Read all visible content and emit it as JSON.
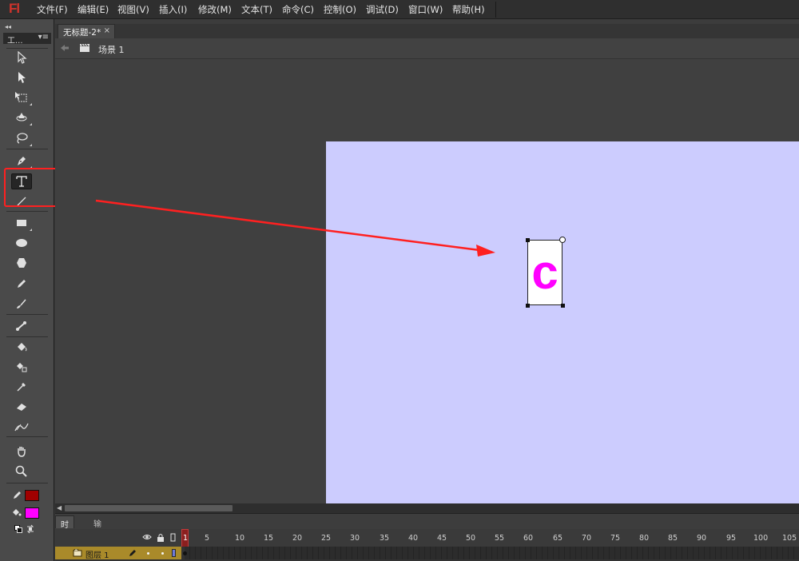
{
  "app": {
    "logo": "Fl"
  },
  "menu": {
    "items": [
      {
        "label": "文件(F)"
      },
      {
        "label": "编辑(E)"
      },
      {
        "label": "视图(V)"
      },
      {
        "label": "插入(I)"
      },
      {
        "label": "修改(M)"
      },
      {
        "label": "文本(T)"
      },
      {
        "label": "命令(C)"
      },
      {
        "label": "控制(O)"
      },
      {
        "label": "调试(D)"
      },
      {
        "label": "窗口(W)"
      },
      {
        "label": "帮助(H)"
      }
    ]
  },
  "tools_panel": {
    "title": "工...",
    "active_tool": "text-tool",
    "tools": [
      "selection-tool",
      "subselection-tool",
      "free-transform-tool",
      "3d-rotation-tool",
      "lasso-tool",
      "pen-tool",
      "text-tool",
      "line-tool",
      "rectangle-tool",
      "oval-tool",
      "polystar-tool",
      "pencil-tool",
      "brush-tool",
      "bone-tool",
      "paint-bucket-tool",
      "ink-bottle-tool",
      "eyedropper-tool",
      "eraser-tool",
      "width-tool",
      "hand-tool",
      "zoom-tool"
    ],
    "stroke_color": "#a00000",
    "fill_color": "#ff00ff"
  },
  "document": {
    "tab_title": "无标题-2*",
    "close_glyph": "×",
    "scene_label": "场景 1",
    "stage_color": "#ccccfe",
    "text_content": "c",
    "text_color": "#ff00ff"
  },
  "timeline": {
    "tabs": [
      "时间轴",
      "输出"
    ],
    "current_frame": "1",
    "frame_numbers": [
      "5",
      "10",
      "15",
      "20",
      "25",
      "30",
      "35",
      "40",
      "45",
      "50",
      "55",
      "60",
      "65",
      "70",
      "75",
      "80",
      "85",
      "90",
      "95",
      "100",
      "105"
    ],
    "layer_name": "图层 1"
  },
  "annotation": {
    "color": "#ff2020"
  }
}
